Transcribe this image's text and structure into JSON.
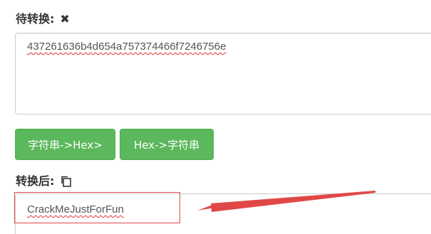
{
  "input_section": {
    "label": "待转换:",
    "clear_icon": "close-icon",
    "value": "437261636b4d654a757374466f7246756e"
  },
  "buttons": {
    "str_to_hex": "字符串->Hex>",
    "hex_to_str": "Hex->字符串"
  },
  "output_section": {
    "label": "转换后:",
    "copy_icon": "copy-icon",
    "value": "CrackMeJustForFun"
  },
  "annotation": {
    "color": "#e04848"
  },
  "colors": {
    "button_green": "#5cb85c",
    "border": "#cccccc",
    "label": "#333333"
  }
}
